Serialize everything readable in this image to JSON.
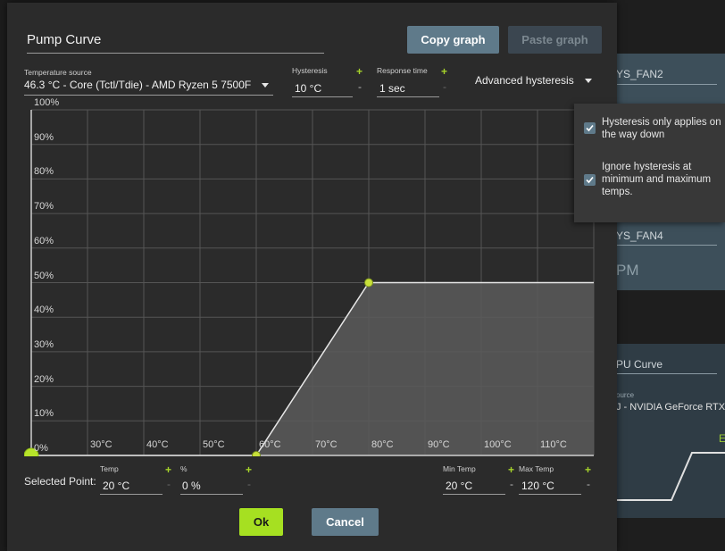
{
  "background": {
    "fan2_label": "YS_FAN2",
    "fan4_label": "YS_FAN4",
    "rpm_label": "PM",
    "gpu_curve_label": "PU Curve",
    "source_label": "ource",
    "gpu_source_value": "J - NVIDIA GeForce RTX",
    "status_letter": "E"
  },
  "dialog": {
    "title": "Pump Curve",
    "copy_graph": "Copy graph",
    "paste_graph": "Paste graph",
    "temperature_source": {
      "label": "Temperature source",
      "value": "46.3 °C - Core (Tctl/Tdie) - AMD Ryzen 5 7500F"
    },
    "hysteresis": {
      "label": "Hysteresis",
      "value": "10 °C"
    },
    "response_time": {
      "label": "Response time",
      "value": "1 sec"
    },
    "advanced_hysteresis": "Advanced hysteresis",
    "selected_point": {
      "label": "Selected Point:",
      "temp_label": "Temp",
      "temp_value": "20 °C",
      "percent_label": "%",
      "percent_value": "0 %"
    },
    "min_temp": {
      "label": "Min Temp",
      "value": "20 °C"
    },
    "max_temp": {
      "label": "Max Temp",
      "value": "120 °C"
    },
    "ok": "Ok",
    "cancel": "Cancel",
    "plus_symbol": "+",
    "minus_symbol": "-"
  },
  "popup": {
    "option1": {
      "label": "Hysteresis only applies on the way down",
      "checked": true
    },
    "option2": {
      "label": "Ignore hysteresis at minimum and maximum temps.",
      "checked": true
    }
  },
  "colors": {
    "accent_green": "#a6e021",
    "button_blue": "#5f7a8a",
    "dialog_bg": "#2b2b2b"
  },
  "chart_data": {
    "type": "area",
    "x_ticks": [
      "30°C",
      "40°C",
      "50°C",
      "60°C",
      "70°C",
      "80°C",
      "90°C",
      "100°C",
      "110°C"
    ],
    "y_ticks": [
      "0%",
      "10%",
      "20%",
      "30%",
      "40%",
      "50%",
      "60%",
      "70%",
      "80%",
      "90%",
      "100%"
    ],
    "xlim": [
      20,
      120
    ],
    "ylim": [
      0,
      100
    ],
    "grid": true,
    "points": [
      {
        "x": 20,
        "y": 0,
        "selected": true
      },
      {
        "x": 60,
        "y": 0
      },
      {
        "x": 80,
        "y": 50
      }
    ],
    "extend_to": {
      "x": 120,
      "y": 50
    }
  }
}
